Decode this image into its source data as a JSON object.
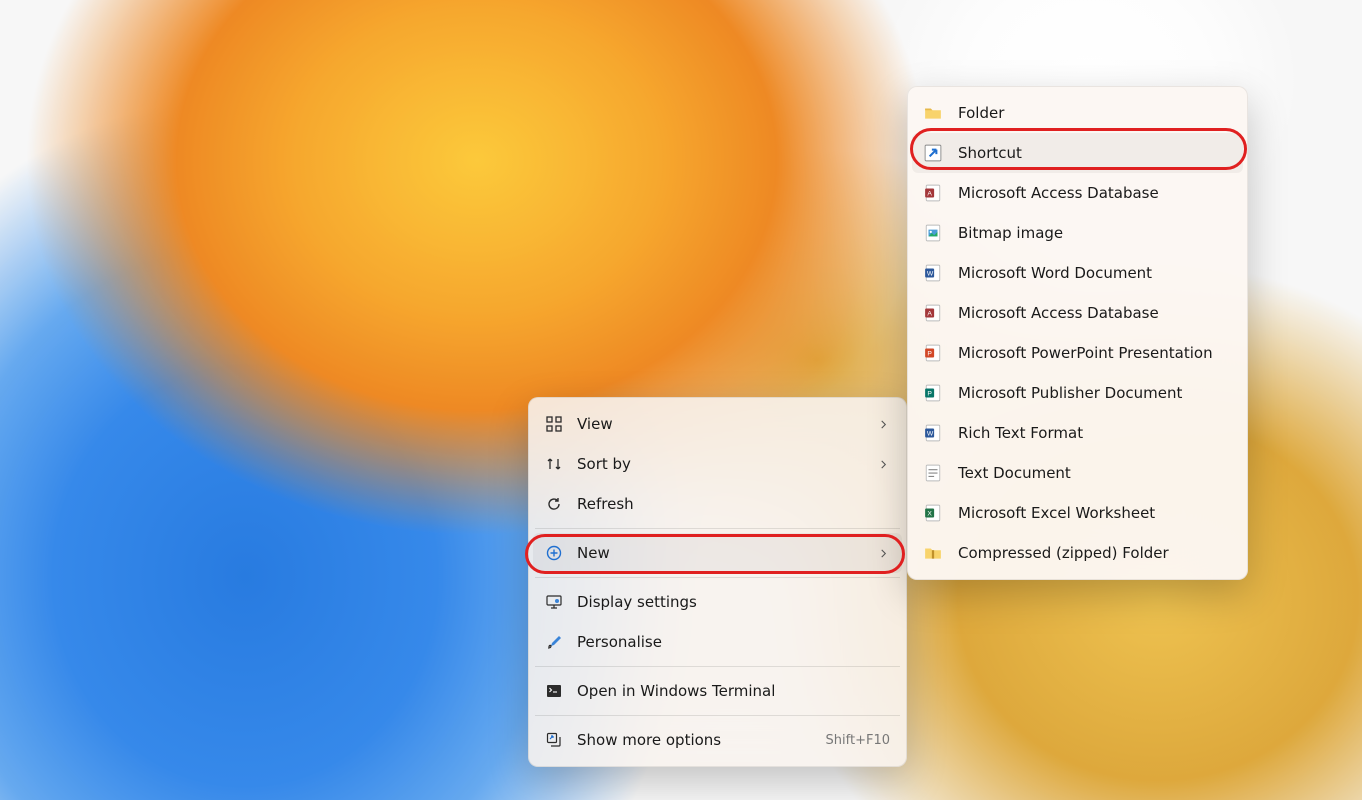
{
  "primaryMenu": {
    "view": "View",
    "sort": "Sort by",
    "refresh": "Refresh",
    "new": "New",
    "display": "Display settings",
    "personalise": "Personalise",
    "terminal": "Open in Windows Terminal",
    "more": "Show more options",
    "moreShortcut": "Shift+F10"
  },
  "submenu": {
    "folder": "Folder",
    "shortcut": "Shortcut",
    "accessdb1": "Microsoft Access Database",
    "bitmap": "Bitmap image",
    "word": "Microsoft Word Document",
    "accessdb2": "Microsoft Access Database",
    "powerpoint": "Microsoft PowerPoint Presentation",
    "publisher": "Microsoft Publisher Document",
    "rtf": "Rich Text Format",
    "text": "Text Document",
    "excel": "Microsoft Excel Worksheet",
    "zip": "Compressed (zipped) Folder"
  },
  "colors": {
    "highlight": "#e02020",
    "menuBg": "rgba(248,242,238,0.88)"
  }
}
